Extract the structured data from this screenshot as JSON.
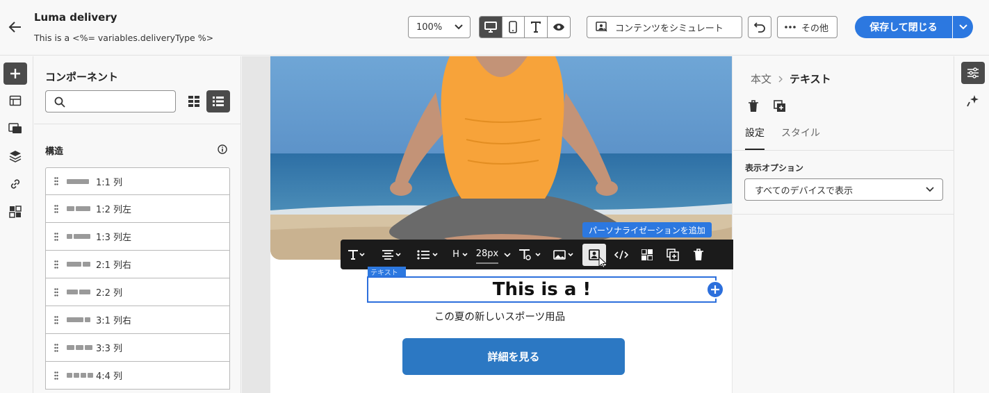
{
  "header": {
    "title": "Luma delivery",
    "subtitle": "This is a <%= variables.deliveryType %>",
    "zoom": "100%",
    "simulate_label": "コンテンツをシミュレート",
    "more_label": "その他",
    "save_label": "保存して閉じる",
    "accent": "#2c78e0"
  },
  "left_rail": {
    "items": [
      "add-icon",
      "template-icon",
      "assets-icon",
      "layers-icon",
      "link-icon",
      "fragments-icon"
    ]
  },
  "components_panel": {
    "title": "コンポーネント",
    "search_placeholder": "",
    "section_title": "構造",
    "structures": [
      {
        "label": "1:1 列",
        "cols": [
          1
        ]
      },
      {
        "label": "1:2 列左",
        "cols": [
          1,
          2
        ]
      },
      {
        "label": "1:3 列左",
        "cols": [
          1,
          3
        ]
      },
      {
        "label": "2:1 列右",
        "cols": [
          2,
          1
        ]
      },
      {
        "label": "2:2 列",
        "cols": [
          1,
          1
        ]
      },
      {
        "label": "3:1 列右",
        "cols": [
          3,
          1
        ]
      },
      {
        "label": "3:3 列",
        "cols": [
          1,
          1,
          1
        ]
      },
      {
        "label": "4:4 列",
        "cols": [
          1,
          1,
          1,
          1
        ]
      }
    ]
  },
  "canvas": {
    "toolbar": {
      "heading_label": "H",
      "font_size": "28px",
      "tooltip": "パーソナライゼーションを追加"
    },
    "selected_label": "テキスト",
    "heading_text": "This is a !",
    "body_text": "この夏の新しいスポーツ用品",
    "cta_label": "詳細を見る"
  },
  "properties": {
    "breadcrumb_parent": "本文",
    "breadcrumb_current": "テキスト",
    "tabs": [
      "設定",
      "スタイル"
    ],
    "display_options_label": "表示オプション",
    "display_options_value": "すべてのデバイスで表示"
  }
}
